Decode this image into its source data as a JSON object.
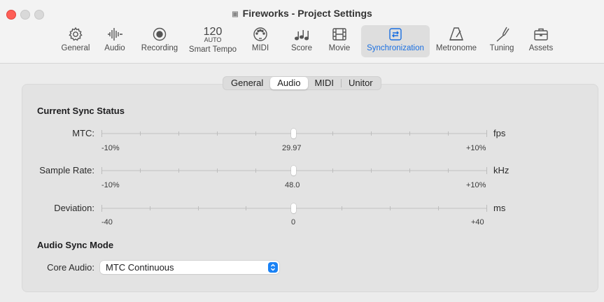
{
  "window": {
    "title": "Fireworks - Project Settings",
    "traffic_colors": {
      "close": "#fe5f57",
      "min": "#d9d9d9",
      "max": "#d9d9d9"
    }
  },
  "toolbar": {
    "items": [
      {
        "label": "General",
        "icon": "gear-icon"
      },
      {
        "label": "Audio",
        "icon": "waveform-icon"
      },
      {
        "label": "Recording",
        "icon": "record-icon"
      },
      {
        "label": "Smart Tempo",
        "icon": "tempo-icon",
        "tempo_value": "120",
        "tempo_mode": "AUTO"
      },
      {
        "label": "MIDI",
        "icon": "midi-port-icon"
      },
      {
        "label": "Score",
        "icon": "music-notes-icon"
      },
      {
        "label": "Movie",
        "icon": "film-icon"
      },
      {
        "label": "Synchronization",
        "icon": "sync-icon",
        "active": true
      },
      {
        "label": "Metronome",
        "icon": "metronome-icon"
      },
      {
        "label": "Tuning",
        "icon": "tuning-fork-icon"
      },
      {
        "label": "Assets",
        "icon": "briefcase-icon"
      }
    ],
    "accent": "#1a6fe0"
  },
  "tabs": {
    "items": [
      "General",
      "Audio",
      "MIDI",
      "Unitor"
    ],
    "selected": "Audio"
  },
  "current_sync": {
    "heading": "Current Sync Status",
    "rows": [
      {
        "label": "MTC:",
        "unit": "fps",
        "min_label": "-10%",
        "center_label": "29.97",
        "max_label": "+10%",
        "value_fraction": 0.5
      },
      {
        "label": "Sample Rate:",
        "unit": "kHz",
        "min_label": "-10%",
        "center_label": "48.0",
        "max_label": "+10%",
        "value_fraction": 0.5
      },
      {
        "label": "Deviation:",
        "unit": "ms",
        "min_label": "-40",
        "center_label": "0",
        "max_label": "+40",
        "value_fraction": 0.5
      }
    ]
  },
  "audio_sync_mode": {
    "heading": "Audio Sync Mode",
    "core_audio_label": "Core Audio:",
    "core_audio_value": "MTC Continuous",
    "accent": "#1a82f5"
  }
}
